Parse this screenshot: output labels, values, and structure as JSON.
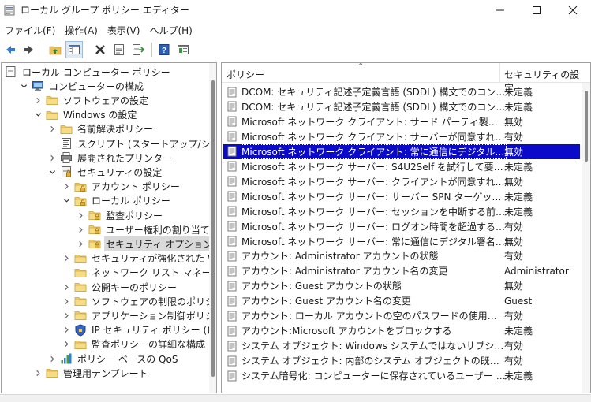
{
  "window": {
    "title": "ローカル グループ ポリシー エディター"
  },
  "menu": [
    {
      "label": "ファイル(F)"
    },
    {
      "label": "操作(A)"
    },
    {
      "label": "表示(V)"
    },
    {
      "label": "ヘルプ(H)"
    }
  ],
  "toolbar": {
    "icons": [
      "back-arrow-icon",
      "forward-arrow-icon",
      "up-folder-icon",
      "show-hide-tree-icon",
      "delete-icon",
      "properties-icon",
      "export-list-icon",
      "help-icon",
      "view-icon"
    ]
  },
  "tree": [
    {
      "label": "ローカル コンピューター ポリシー",
      "depth": 0,
      "chevron": "none",
      "icon": "policy-computer-icon"
    },
    {
      "label": "コンピューターの構成",
      "depth": 1,
      "chevron": "open",
      "icon": "computer-icon"
    },
    {
      "label": "ソフトウェアの設定",
      "depth": 2,
      "chevron": "closed",
      "icon": "folder-icon"
    },
    {
      "label": "Windows の設定",
      "depth": 2,
      "chevron": "open",
      "icon": "folder-icon"
    },
    {
      "label": "名前解決ポリシー",
      "depth": 3,
      "chevron": "closed",
      "icon": "folder-icon"
    },
    {
      "label": "スクリプト (スタートアップ/シャットダウン)",
      "depth": 3,
      "chevron": "none",
      "icon": "script-icon"
    },
    {
      "label": "展開されたプリンター",
      "depth": 3,
      "chevron": "closed",
      "icon": "printer-icon"
    },
    {
      "label": "セキュリティの設定",
      "depth": 3,
      "chevron": "open",
      "icon": "security-settings-icon"
    },
    {
      "label": "アカウント ポリシー",
      "depth": 4,
      "chevron": "closed",
      "icon": "folder-icon"
    },
    {
      "label": "ローカル ポリシー",
      "depth": 4,
      "chevron": "open",
      "icon": "folder-icon"
    },
    {
      "label": "監査ポリシー",
      "depth": 5,
      "chevron": "closed",
      "icon": "folder-icon"
    },
    {
      "label": "ユーザー権利の割り当て",
      "depth": 5,
      "chevron": "closed",
      "icon": "folder-icon"
    },
    {
      "label": "セキュリティ オプション",
      "depth": 5,
      "chevron": "closed",
      "icon": "folder-icon",
      "selected": true
    },
    {
      "label": "セキュリティが強化された Windows",
      "depth": 4,
      "chevron": "closed",
      "icon": "folder-icon"
    },
    {
      "label": "ネットワーク リスト マネージャー ポリ",
      "depth": 4,
      "chevron": "none",
      "icon": "folder-icon"
    },
    {
      "label": "公開キーのポリシー",
      "depth": 4,
      "chevron": "closed",
      "icon": "folder-icon"
    },
    {
      "label": "ソフトウェアの制限のポリシー",
      "depth": 4,
      "chevron": "closed",
      "icon": "folder-icon"
    },
    {
      "label": "アプリケーション制御ポリシー",
      "depth": 4,
      "chevron": "closed",
      "icon": "folder-icon"
    },
    {
      "label": "IP セキュリティ ポリシー (ローカル コ",
      "depth": 4,
      "chevron": "closed",
      "icon": "ip-security-icon"
    },
    {
      "label": "監査ポリシーの詳細な構成",
      "depth": 4,
      "chevron": "closed",
      "icon": "folder-icon"
    },
    {
      "label": "ポリシー ベースの QoS",
      "depth": 3,
      "chevron": "closed",
      "icon": "qos-chart-icon"
    },
    {
      "label": "管理用テンプレート",
      "depth": 2,
      "chevron": "closed",
      "icon": "folder-icon"
    }
  ],
  "list": {
    "headers": {
      "policy": "ポリシー",
      "setting": "セキュリティの設定"
    },
    "rows": [
      {
        "policy": "DCOM: セキュリティ記述子定義言語 (SDDL) 構文でのコンピュータ...",
        "setting": "未定義"
      },
      {
        "policy": "DCOM: セキュリティ記述子定義言語 (SDDL) 構文でのコンピュータ...",
        "setting": "未定義"
      },
      {
        "policy": "Microsoft ネットワーク クライアント: サード パーティ製の SMB サーバ...",
        "setting": "無効"
      },
      {
        "policy": "Microsoft ネットワーク クライアント: サーバーが同意すれば、通信に...",
        "setting": "有効"
      },
      {
        "policy": "Microsoft ネットワーク クライアント: 常に通信にデジタル署名を行う",
        "setting": "無効",
        "selected": true
      },
      {
        "policy": "Microsoft ネットワーク サーバー: S4U2Self を試行して要求情報を...",
        "setting": "未定義"
      },
      {
        "policy": "Microsoft ネットワーク サーバー: クライアントが同意すれば、通信に...",
        "setting": "無効"
      },
      {
        "policy": "Microsoft ネットワーク サーバー: サーバー SPN ターゲット名検証レベル",
        "setting": "未定義"
      },
      {
        "policy": "Microsoft ネットワーク サーバー: セッションを中断する前に、ある一...",
        "setting": "未定義"
      },
      {
        "policy": "Microsoft ネットワーク サーバー: ログオン時間を超過するとクライア...",
        "setting": "有効"
      },
      {
        "policy": "Microsoft ネットワーク サーバー: 常に通信にデジタル署名を行う",
        "setting": "無効"
      },
      {
        "policy": "アカウント: Administrator アカウントの状態",
        "setting": "有効"
      },
      {
        "policy": "アカウント: Administrator アカウント名の変更",
        "setting": "Administrator"
      },
      {
        "policy": "アカウント: Guest アカウントの状態",
        "setting": "無効"
      },
      {
        "policy": "アカウント: Guest アカウント名の変更",
        "setting": "Guest"
      },
      {
        "policy": "アカウント: ローカル アカウントの空のパスワードの使用をコンソール ログ...",
        "setting": "有効"
      },
      {
        "policy": "アカウント:Microsoft アカウントをブロックする",
        "setting": "未定義"
      },
      {
        "policy": "システム オブジェクト: Windows システムではないサブシステムのため...",
        "setting": "有効"
      },
      {
        "policy": "システム オブジェクト: 内部のシステム オブジェクトの既定のアクセス許...",
        "setting": "有効"
      },
      {
        "policy": "システム暗号化: コンピューターに保存されているユーザー キーに強力な...",
        "setting": "未定義"
      }
    ]
  }
}
